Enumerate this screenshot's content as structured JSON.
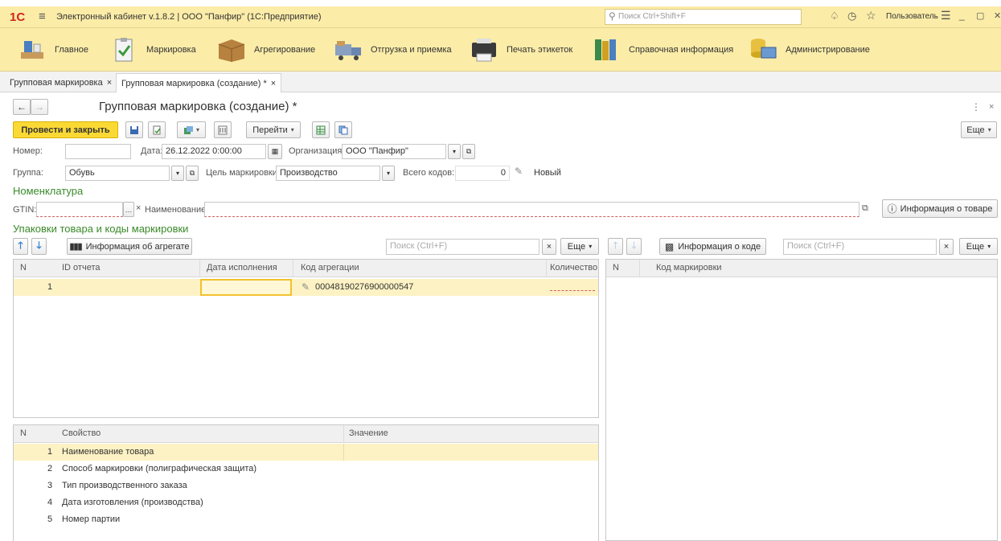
{
  "app": {
    "logo": "1С",
    "title": "Электронный кабинет v.1.8.2 | ООО \"Панфир\"  (1С:Предприятие)",
    "search_placeholder": "Поиск Ctrl+Shift+F",
    "user_label": "Пользователь"
  },
  "sections": [
    {
      "label": "Главное",
      "icon": "home-desk-icon"
    },
    {
      "label": "Маркировка",
      "icon": "clipboard-check-icon"
    },
    {
      "label": "Агрегирование",
      "icon": "box-icon"
    },
    {
      "label": "Отгрузка и приемка",
      "icon": "truck-icon"
    },
    {
      "label": "Печать этикеток",
      "icon": "printer-icon"
    },
    {
      "label": "Справочная информация",
      "icon": "books-icon"
    },
    {
      "label": "Администрирование",
      "icon": "database-computer-icon"
    }
  ],
  "open_tabs": [
    {
      "label": "Групповая маркировка"
    },
    {
      "label": "Групповая маркировка (создание) *"
    }
  ],
  "form": {
    "title": "Групповая маркировка (создание) *",
    "post_close_label": "Провести и закрыть",
    "goto_label": "Перейти",
    "more_label": "Еще",
    "number_label": "Номер:",
    "number_value": "",
    "date_label": "Дата:",
    "date_value": "26.12.2022  0:00:00",
    "org_label": "Организация:",
    "org_value": "ООО \"Панфир\"",
    "group_label": "Группа:",
    "group_value": "Обувь",
    "purpose_label": "Цель маркировки:",
    "purpose_value": "Производство",
    "total_codes_label": "Всего кодов:",
    "total_codes_value": "0",
    "status_text": "Новый"
  },
  "nomenclature": {
    "header": "Номенклатура",
    "gtin_label": "GTIN:",
    "gtin_value": "",
    "name_label": "Наименование:",
    "name_value": "",
    "info_button": "Информация о товаре"
  },
  "packages": {
    "header": "Упаковки товара и коды маркировки",
    "aggregate_info_button": "Информация об агрегате",
    "search_placeholder": "Поиск (Ctrl+F)",
    "more_label": "Еще",
    "columns": [
      "N",
      "ID отчета",
      "Дата исполнения",
      "Код агрегации",
      "Количество"
    ],
    "rows": [
      {
        "n": "1",
        "report_id": "",
        "date": "",
        "agg_code": "00048190276900000547",
        "qty": ""
      }
    ]
  },
  "codes": {
    "code_info_button": "Информация о коде",
    "search_placeholder": "Поиск (Ctrl+F)",
    "more_label": "Еще",
    "columns": [
      "N",
      "Код маркировки"
    ]
  },
  "properties": {
    "columns": [
      "N",
      "Свойство",
      "Значение"
    ],
    "rows": [
      {
        "n": "1",
        "name": "Наименование товара",
        "value": ""
      },
      {
        "n": "2",
        "name": "Способ маркировки (полиграфическая защита)",
        "value": ""
      },
      {
        "n": "3",
        "name": "Тип производственного заказа",
        "value": ""
      },
      {
        "n": "4",
        "name": "Дата изготовления (производства)",
        "value": ""
      },
      {
        "n": "5",
        "name": "Номер партии",
        "value": ""
      }
    ]
  },
  "colors": {
    "accent_yellow": "#fbd935",
    "section_bar": "#fbeca8",
    "selected_row": "#fdf2c4",
    "header_green": "#3a8a2a"
  }
}
